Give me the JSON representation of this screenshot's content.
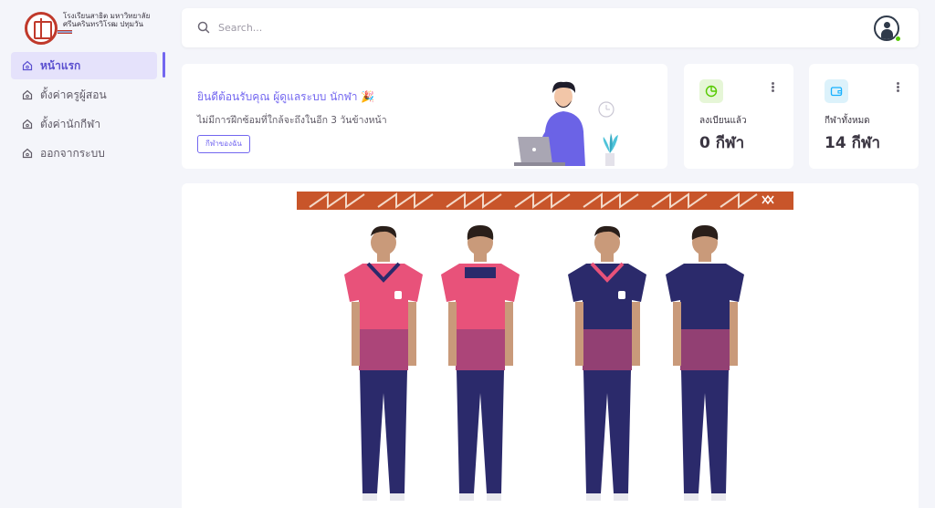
{
  "sidebar": {
    "logo_text": "โรงเรียนสาธิต มหาวิทยาลัยศรีนครินทรวิโรฒ ปทุมวัน",
    "items": [
      {
        "label": "หน้าแรก",
        "active": true
      },
      {
        "label": "ตั้งค่าครูผู้สอน",
        "active": false
      },
      {
        "label": "ตั้งค่านักกีฬา",
        "active": false
      },
      {
        "label": "ออกจากระบบ",
        "active": false
      }
    ]
  },
  "search": {
    "placeholder": "Search..."
  },
  "welcome": {
    "title": "ยินดีต้อนรับคุณ ผู้ดูแลระบบ นักฬา 🎉",
    "subtitle": "ไม่มีการฝึกซ้อมที่ใกล้จะถึงในอีก 3 วันข้างหน้า",
    "button": "กีฬาของฉัน"
  },
  "stats": [
    {
      "label": "ลงเบียนแล้ว",
      "value": "0 กีฬา",
      "icon": "pie-chart-icon",
      "color": "#56ca00"
    },
    {
      "label": "กีฬาทั้งหมด",
      "value": "14 กีฬา",
      "icon": "wallet-icon",
      "color": "#16b1ff"
    }
  ],
  "colors": {
    "accent": "#7367f0",
    "pink_shirt": "#e8527a",
    "navy": "#2b2a6b",
    "banner_orange": "#c8552a"
  }
}
